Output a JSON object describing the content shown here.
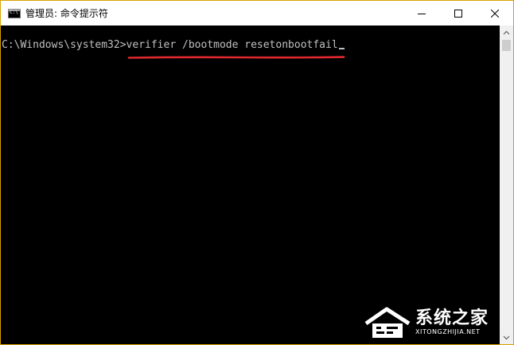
{
  "window": {
    "title": "管理员: 命令提示符",
    "app_icon": "console-icon",
    "controls": {
      "minimize_icon": "minimize-icon",
      "maximize_icon": "maximize-icon",
      "close_icon": "close-icon"
    }
  },
  "console": {
    "prompt": "C:\\Windows\\system32>",
    "command": "verifier /bootmode resetonbootfail",
    "highlight_color": "#e0282e"
  },
  "watermark": {
    "title": "系统之家",
    "subtitle": "XITONGZHIJIA.NET"
  },
  "colors": {
    "border": "#d8a100",
    "titlebar": "#ffffff",
    "console_bg": "#000000",
    "console_text": "#c0c0c0"
  }
}
